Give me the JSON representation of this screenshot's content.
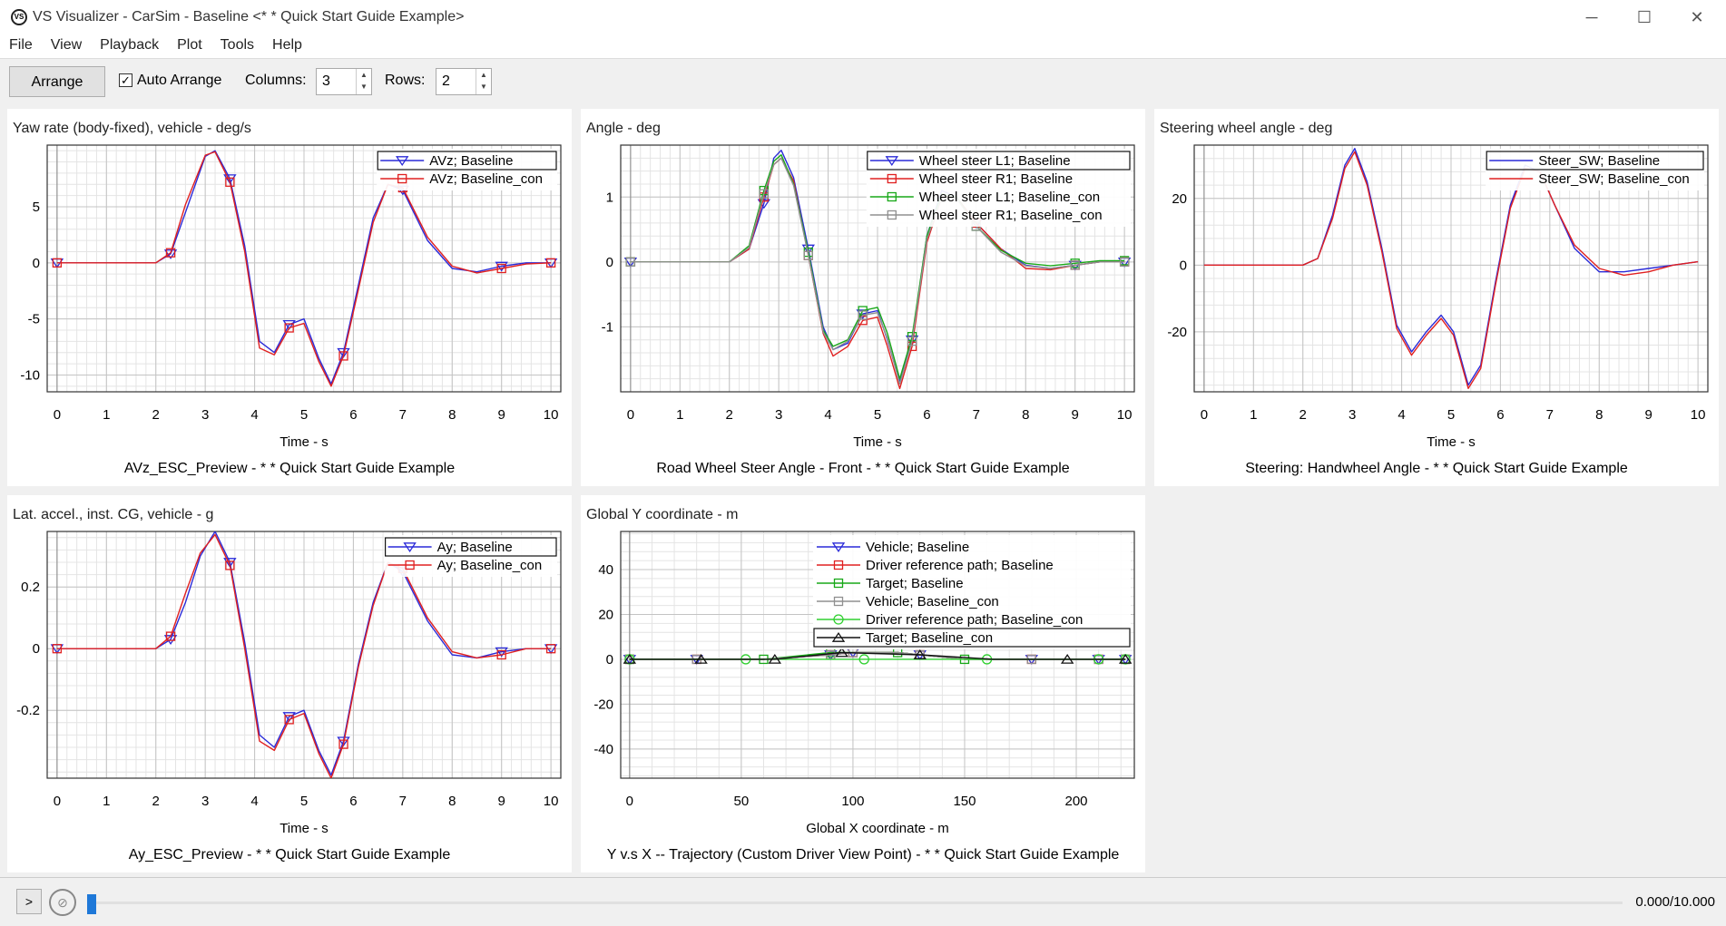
{
  "window": {
    "title": "VS Visualizer - CarSim - Baseline <* * Quick Start Guide Example>",
    "minimize": "─",
    "maximize": "☐",
    "close": "✕"
  },
  "menu": [
    "File",
    "View",
    "Playback",
    "Plot",
    "Tools",
    "Help"
  ],
  "toolbar": {
    "arrange_label": "Arrange",
    "auto_arrange_label": "Auto Arrange",
    "auto_arrange_checked": true,
    "columns_label": "Columns:",
    "columns_value": "3",
    "rows_label": "Rows:",
    "rows_value": "2"
  },
  "statusbar": {
    "play_label": ">",
    "time_readout": "0.000/10.000",
    "progress": 0.0
  },
  "colors": {
    "blue": "#2a2ad8",
    "red": "#e02020",
    "green": "#18a818",
    "gray": "#909090",
    "lightgreen": "#30d030",
    "black": "#111111"
  },
  "chart_data": [
    {
      "type": "line",
      "title": "Yaw rate (body-fixed), vehicle - deg/s",
      "xlabel": "Time - s",
      "caption": "AVz_ESC_Preview - * * Quick Start Guide Example",
      "xlim": [
        -0.2,
        10.2
      ],
      "ylim": [
        -11.5,
        10.5
      ],
      "xticks": [
        0,
        1,
        2,
        3,
        4,
        5,
        6,
        7,
        8,
        9,
        10
      ],
      "yticks": [
        5,
        0,
        -5,
        -10
      ],
      "series": [
        {
          "name": "AVz; Baseline",
          "color": "blue",
          "marker": "tri",
          "x": [
            0,
            1,
            2,
            2.3,
            2.6,
            3,
            3.2,
            3.5,
            3.8,
            4.1,
            4.4,
            4.7,
            5,
            5.3,
            5.55,
            5.8,
            6.1,
            6.4,
            6.7,
            7,
            7.5,
            8,
            8.5,
            9,
            9.5,
            10
          ],
          "y": [
            0,
            0,
            0,
            0.8,
            4.5,
            9.5,
            10.0,
            7.5,
            1.5,
            -7.0,
            -8.0,
            -5.5,
            -5.0,
            -8.5,
            -10.8,
            -8.0,
            -2.0,
            4.0,
            7.0,
            6.5,
            2.0,
            -0.5,
            -0.8,
            -0.3,
            0,
            0
          ]
        },
        {
          "name": "AVz; Baseline_con",
          "color": "red",
          "marker": "sq",
          "x": [
            0,
            1,
            2,
            2.3,
            2.6,
            3,
            3.2,
            3.5,
            3.8,
            4.1,
            4.4,
            4.7,
            5,
            5.3,
            5.55,
            5.8,
            6.1,
            6.4,
            6.7,
            7,
            7.5,
            8,
            8.5,
            9,
            9.5,
            10
          ],
          "y": [
            0,
            0,
            0,
            0.9,
            5.2,
            9.6,
            9.9,
            7.2,
            1.0,
            -7.6,
            -8.2,
            -5.8,
            -5.4,
            -8.8,
            -11.0,
            -8.3,
            -2.4,
            3.6,
            7.0,
            6.7,
            2.3,
            -0.3,
            -0.9,
            -0.5,
            -0.1,
            0
          ]
        }
      ]
    },
    {
      "type": "line",
      "title": "Angle - deg",
      "xlabel": "Time - s",
      "caption": "Road Wheel Steer Angle - Front - * * Quick Start Guide Example",
      "xlim": [
        -0.2,
        10.2
      ],
      "ylim": [
        -2.0,
        1.8
      ],
      "xticks": [
        0,
        1,
        2,
        3,
        4,
        5,
        6,
        7,
        8,
        9,
        10
      ],
      "yticks": [
        1,
        0,
        -1
      ],
      "series": [
        {
          "name": "Wheel steer L1; Baseline",
          "color": "blue",
          "marker": "tri",
          "x": [
            0,
            1,
            2,
            2.4,
            2.7,
            2.9,
            3.05,
            3.3,
            3.6,
            3.9,
            4.1,
            4.4,
            4.7,
            5,
            5.2,
            5.45,
            5.7,
            6,
            6.3,
            6.6,
            7,
            7.5,
            8,
            8.5,
            9,
            9.5,
            10
          ],
          "y": [
            0,
            0,
            0,
            0.2,
            0.9,
            1.6,
            1.72,
            1.3,
            0.2,
            -1.0,
            -1.35,
            -1.25,
            -0.8,
            -0.75,
            -1.2,
            -1.85,
            -1.2,
            0.4,
            1.1,
            1.0,
            0.6,
            0.2,
            -0.05,
            -0.1,
            -0.05,
            0.0,
            0.0
          ]
        },
        {
          "name": "Wheel steer R1; Baseline",
          "color": "red",
          "marker": "sq",
          "x": [
            0,
            1,
            2,
            2.4,
            2.7,
            2.9,
            3.05,
            3.3,
            3.6,
            3.9,
            4.1,
            4.4,
            4.7,
            5,
            5.2,
            5.45,
            5.7,
            6,
            6.3,
            6.6,
            7,
            7.5,
            8,
            8.5,
            9,
            9.5,
            10
          ],
          "y": [
            0,
            0,
            0,
            0.2,
            1.0,
            1.5,
            1.6,
            1.25,
            0.1,
            -1.1,
            -1.45,
            -1.3,
            -0.9,
            -0.85,
            -1.3,
            -1.95,
            -1.3,
            0.3,
            1.0,
            1.0,
            0.6,
            0.2,
            -0.1,
            -0.12,
            -0.05,
            0.0,
            0.0
          ]
        },
        {
          "name": "Wheel steer L1; Baseline_con",
          "color": "green",
          "marker": "sq",
          "x": [
            0,
            1,
            2,
            2.4,
            2.7,
            2.9,
            3.05,
            3.3,
            3.6,
            3.9,
            4.1,
            4.4,
            4.7,
            5,
            5.2,
            5.45,
            5.7,
            6,
            6.3,
            6.6,
            7,
            7.5,
            8,
            8.5,
            9,
            9.5,
            10
          ],
          "y": [
            0,
            0,
            0,
            0.25,
            1.1,
            1.55,
            1.65,
            1.2,
            0.15,
            -1.05,
            -1.3,
            -1.2,
            -0.75,
            -0.7,
            -1.1,
            -1.8,
            -1.15,
            0.4,
            1.05,
            1.0,
            0.55,
            0.18,
            -0.02,
            -0.06,
            -0.02,
            0.02,
            0.02
          ]
        },
        {
          "name": "Wheel steer R1; Baseline_con",
          "color": "gray",
          "marker": "sq",
          "x": [
            0,
            1,
            2,
            2.4,
            2.7,
            2.9,
            3.05,
            3.3,
            3.6,
            3.9,
            4.1,
            4.4,
            4.7,
            5,
            5.2,
            5.45,
            5.7,
            6,
            6.3,
            6.6,
            7,
            7.5,
            8,
            8.5,
            9,
            9.5,
            10
          ],
          "y": [
            0,
            0,
            0,
            0.22,
            1.05,
            1.5,
            1.6,
            1.18,
            0.1,
            -1.08,
            -1.35,
            -1.22,
            -0.82,
            -0.78,
            -1.18,
            -1.88,
            -1.22,
            0.35,
            1.0,
            0.98,
            0.55,
            0.15,
            -0.06,
            -0.1,
            -0.05,
            0.0,
            0.0
          ]
        }
      ]
    },
    {
      "type": "line",
      "title": "Steering wheel angle - deg",
      "xlabel": "Time - s",
      "caption": "Steering: Handwheel Angle - * * Quick Start Guide Example",
      "xlim": [
        -0.2,
        10.2
      ],
      "ylim": [
        -38,
        36
      ],
      "xticks": [
        0,
        1,
        2,
        3,
        4,
        5,
        6,
        7,
        8,
        9,
        10
      ],
      "yticks": [
        20,
        0,
        -20
      ],
      "series": [
        {
          "name": "Steer_SW; Baseline",
          "color": "blue",
          "marker": "none",
          "x": [
            0,
            1,
            2,
            2.3,
            2.6,
            2.85,
            3.05,
            3.3,
            3.6,
            3.9,
            4.2,
            4.5,
            4.8,
            5.05,
            5.35,
            5.6,
            5.9,
            6.2,
            6.5,
            6.8,
            7.1,
            7.5,
            8,
            8.5,
            9,
            9.5,
            10
          ],
          "y": [
            0,
            0,
            0,
            2,
            15,
            30,
            35,
            25,
            5,
            -18,
            -26,
            -20,
            -15,
            -20,
            -36,
            -30,
            -5,
            18,
            30,
            28,
            18,
            5,
            -2,
            -2,
            -1,
            0,
            1
          ]
        },
        {
          "name": "Steer_SW; Baseline_con",
          "color": "red",
          "marker": "none",
          "x": [
            0,
            1,
            2,
            2.3,
            2.6,
            2.85,
            3.05,
            3.3,
            3.6,
            3.9,
            4.2,
            4.5,
            4.8,
            5.05,
            5.35,
            5.6,
            5.9,
            6.2,
            6.5,
            6.8,
            7.1,
            7.5,
            8,
            8.5,
            9,
            9.5,
            10
          ],
          "y": [
            0,
            0,
            0,
            2,
            14,
            29,
            34,
            24,
            4,
            -19,
            -27,
            -21,
            -16,
            -21,
            -37,
            -31,
            -6,
            17,
            29,
            28,
            18,
            6,
            -1,
            -3,
            -2,
            0,
            1
          ]
        }
      ]
    },
    {
      "type": "line",
      "title": "Lat. accel., inst. CG, vehicle - g",
      "xlabel": "Time - s",
      "caption": "Ay_ESC_Preview - * * Quick Start Guide Example",
      "xlim": [
        -0.2,
        10.2
      ],
      "ylim": [
        -0.42,
        0.38
      ],
      "xticks": [
        0,
        1,
        2,
        3,
        4,
        5,
        6,
        7,
        8,
        9,
        10
      ],
      "yticks": [
        0.2,
        0,
        -0.2
      ],
      "series": [
        {
          "name": "Ay; Baseline",
          "color": "blue",
          "marker": "tri",
          "x": [
            0,
            1,
            2,
            2.3,
            2.6,
            2.9,
            3.2,
            3.5,
            3.8,
            4.1,
            4.4,
            4.7,
            5,
            5.3,
            5.55,
            5.8,
            6.1,
            6.4,
            6.7,
            7,
            7.5,
            8,
            8.5,
            9,
            9.5,
            10
          ],
          "y": [
            0,
            0,
            0,
            0.03,
            0.15,
            0.3,
            0.38,
            0.28,
            0.02,
            -0.28,
            -0.32,
            -0.22,
            -0.2,
            -0.33,
            -0.41,
            -0.3,
            -0.05,
            0.15,
            0.28,
            0.25,
            0.09,
            -0.02,
            -0.03,
            -0.01,
            0,
            0
          ]
        },
        {
          "name": "Ay; Baseline_con",
          "color": "red",
          "marker": "sq",
          "x": [
            0,
            1,
            2,
            2.3,
            2.6,
            2.9,
            3.2,
            3.5,
            3.8,
            4.1,
            4.4,
            4.7,
            5,
            5.3,
            5.55,
            5.8,
            6.1,
            6.4,
            6.7,
            7,
            7.5,
            8,
            8.5,
            9,
            9.5,
            10
          ],
          "y": [
            0,
            0,
            0,
            0.04,
            0.18,
            0.31,
            0.37,
            0.27,
            0.0,
            -0.3,
            -0.33,
            -0.23,
            -0.21,
            -0.34,
            -0.42,
            -0.31,
            -0.06,
            0.14,
            0.28,
            0.26,
            0.1,
            -0.01,
            -0.03,
            -0.02,
            0,
            0
          ]
        }
      ]
    },
    {
      "type": "line",
      "title": "Global Y coordinate - m",
      "xlabel": "Global X coordinate - m",
      "caption": "Y v.s X -- Trajectory (Custom Driver View Point) - * * Quick Start Guide Example",
      "xlim": [
        -4,
        226
      ],
      "ylim": [
        -53,
        57
      ],
      "xticks": [
        0,
        50,
        100,
        150,
        200
      ],
      "yticks": [
        40,
        20,
        0,
        -20,
        -40
      ],
      "series": [
        {
          "name": "Vehicle; Baseline",
          "color": "blue",
          "marker": "tri",
          "x": [
            0,
            30,
            60,
            90,
            100,
            120,
            130,
            150,
            180,
            210,
            222
          ],
          "y": [
            0,
            0,
            0,
            2,
            3,
            3,
            2,
            0,
            0,
            0,
            0
          ]
        },
        {
          "name": "Driver reference path; Baseline",
          "color": "red",
          "marker": "sq",
          "x": [
            0,
            30,
            60,
            90,
            100,
            120,
            130,
            150,
            180,
            210,
            222
          ],
          "y": [
            0,
            0,
            0,
            2,
            3,
            3,
            2,
            0,
            0,
            0,
            0
          ]
        },
        {
          "name": "Target; Baseline",
          "color": "green",
          "marker": "sq",
          "x": [
            0,
            60,
            90,
            120,
            150,
            222
          ],
          "y": [
            0,
            0,
            3,
            3,
            0,
            0
          ]
        },
        {
          "name": "Vehicle; Baseline_con",
          "color": "gray",
          "marker": "sq",
          "x": [
            0,
            30,
            60,
            90,
            100,
            120,
            130,
            150,
            180,
            210,
            222
          ],
          "y": [
            0,
            0,
            0,
            2,
            3,
            3,
            2,
            0,
            0,
            0,
            0
          ]
        },
        {
          "name": "Driver reference path; Baseline_con",
          "color": "lightgreen",
          "marker": "circ",
          "x": [
            0,
            52,
            105,
            160,
            210,
            222
          ],
          "y": [
            0,
            0,
            0,
            0,
            0,
            0
          ]
        },
        {
          "name": "Target; Baseline_con",
          "color": "black",
          "marker": "tri-up",
          "x": [
            0,
            32,
            65,
            95,
            130,
            163,
            196,
            222
          ],
          "y": [
            0,
            0,
            0,
            3,
            2,
            0,
            0,
            0
          ]
        }
      ]
    }
  ]
}
